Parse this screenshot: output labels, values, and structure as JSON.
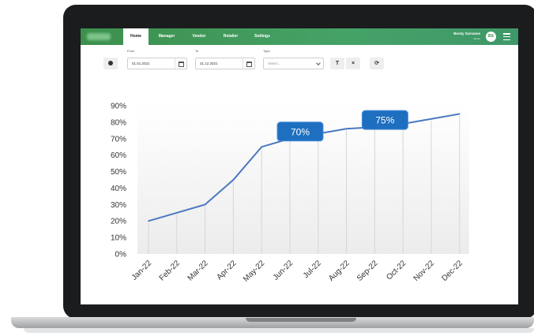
{
  "nav": {
    "tabs": [
      {
        "label": "Home",
        "active": true
      },
      {
        "label": "Manager",
        "active": false
      },
      {
        "label": "Vendor",
        "active": false
      },
      {
        "label": "Retailer",
        "active": false
      },
      {
        "label": "Settings",
        "active": false
      }
    ],
    "user_name": "Becky Surname",
    "user_sub": "Admin",
    "avatar_initials": "BS",
    "menu_icon": "hamburger-icon",
    "brand_color": "#3f9868"
  },
  "filters": {
    "from_label": "From",
    "from_value": "01.01.2021",
    "to_label": "To",
    "to_value": "31.12.2021",
    "type_label": "Type",
    "type_placeholder": "Select...",
    "filter_icon": "T",
    "clear_icon": "×",
    "refresh_icon": "⟳",
    "clock_icon": "clock-icon",
    "calendar_icon": "calendar-icon"
  },
  "chart_data": {
    "type": "line",
    "categories": [
      "Jan-22",
      "Feb-22",
      "Mar-22",
      "Apr-22",
      "May-22",
      "Jun-22",
      "Jul-22",
      "Aug-22",
      "Sep-22",
      "Oct-22",
      "Nov-22",
      "Dec-22"
    ],
    "values": [
      20,
      25,
      30,
      45,
      65,
      70,
      73,
      76,
      77,
      79,
      82,
      85
    ],
    "y_ticks": [
      "0%",
      "10%",
      "20%",
      "30%",
      "40%",
      "50%",
      "60%",
      "70%",
      "80%",
      "90%"
    ],
    "ylim": [
      0,
      90
    ],
    "grid": "vertical",
    "line_color": "#4a78c2",
    "callouts": [
      {
        "label": "70%",
        "index": 5
      },
      {
        "label": "75%",
        "index": 8
      }
    ],
    "callout_color": "#1e6fc0"
  }
}
